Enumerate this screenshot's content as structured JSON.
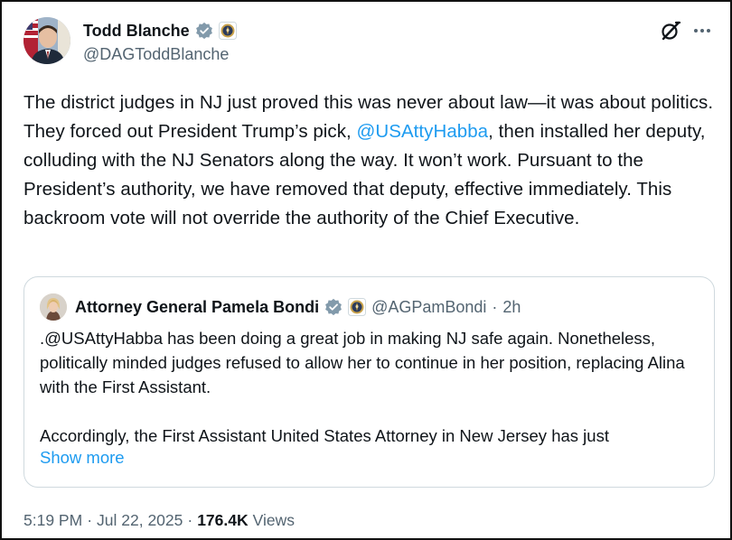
{
  "author": {
    "display_name": "Todd Blanche",
    "handle": "@DAGToddBlanche",
    "avatar": "todd-blanche-avatar"
  },
  "icons": {
    "verified": "verified-badge-icon",
    "affiliate": "doj-seal-icon",
    "grok": "grok-icon",
    "more": "more-options-icon"
  },
  "tweet": {
    "text_before": "The district judges in NJ just proved this was never about law—it was about politics. They forced out President Trump’s pick, ",
    "mention": "@USAttyHabba",
    "text_after": ", then installed her deputy, colluding with the NJ Senators along the way. It won’t work. Pursuant to the President’s authority, we have removed that deputy, effective immediately. This backroom vote will not override the authority of the Chief Executive."
  },
  "quote": {
    "display_name": "Attorney General Pamela Bondi",
    "handle": "@AGPamBondi",
    "separator": "·",
    "time": "2h",
    "paragraph1": ".@USAttyHabba has been doing a great job in making NJ safe again. Nonetheless, politically minded judges refused to allow her to continue in her position, replacing Alina with the First Assistant.",
    "paragraph2": "Accordingly, the First Assistant United States Attorney in New Jersey has just",
    "show_more": "Show more"
  },
  "meta": {
    "time": "5:19 PM",
    "dot1": "·",
    "date": "Jul 22, 2025",
    "dot2": "·",
    "views_count": "176.4K",
    "views_label": "Views"
  },
  "colors": {
    "link": "#1d9bf0",
    "secondary": "#536471",
    "primary": "#0f1419",
    "border": "#cfd9de"
  }
}
